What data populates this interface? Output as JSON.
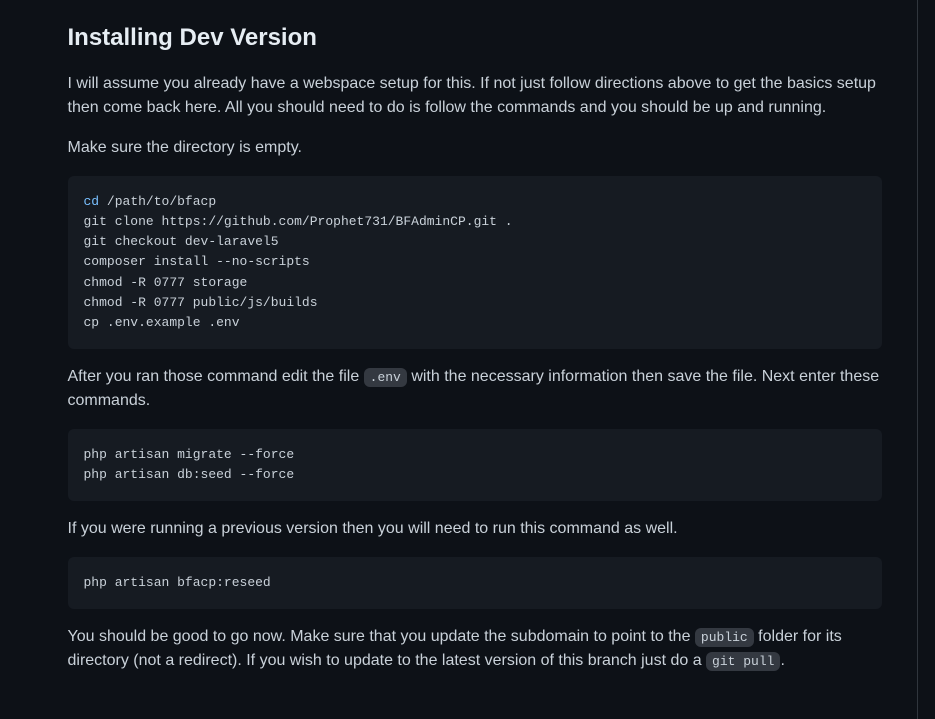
{
  "heading": "Installing Dev Version",
  "para1": "I will assume you already have a webspace setup for this. If not just follow directions above to get the basics setup then come back here. All you should need to do is follow the commands and you should be up and running.",
  "para2": "Make sure the directory is empty.",
  "code1_kw": "cd",
  "code1_rest": " /path/to/bfacp\ngit clone https://github.com/Prophet731/BFAdminCP.git .\ngit checkout dev-laravel5\ncomposer install --no-scripts\nchmod -R 0777 storage\nchmod -R 0777 public/js/builds\ncp .env.example .env",
  "para3_a": "After you ran those command edit the file ",
  "para3_code": ".env",
  "para3_b": " with the necessary information then save the file. Next enter these commands.",
  "code2": "php artisan migrate --force\nphp artisan db:seed --force",
  "para4": "If you were running a previous version then you will need to run this command as well.",
  "code3": "php artisan bfacp:reseed",
  "para5_a": "You should be good to go now. Make sure that you update the subdomain to point to the ",
  "para5_code1": "public",
  "para5_b": " folder for its directory (not a redirect). If you wish to update to the latest version of this branch just do a ",
  "para5_code2": "git pull",
  "para5_c": "."
}
